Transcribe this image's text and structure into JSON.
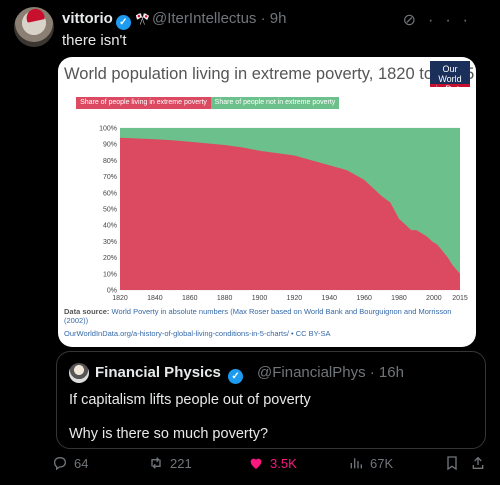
{
  "tweet": {
    "author_name": "vittorio",
    "handle_time": "@IterIntellectus · 9h",
    "text": "there isn't"
  },
  "chart_data": {
    "type": "area",
    "title": "World population living in extreme poverty, 1820 to 2015",
    "logo": "Our World in Data",
    "legend": [
      "Share of people living in extreme poverty",
      "Share of people not in extreme poverty"
    ],
    "x_ticks": [
      "1820",
      "1840",
      "1860",
      "1880",
      "1900",
      "1920",
      "1940",
      "1960",
      "1980",
      "2000",
      "2015"
    ],
    "y_ticks": [
      "0%",
      "10%",
      "20%",
      "30%",
      "40%",
      "50%",
      "60%",
      "70%",
      "80%",
      "90%",
      "100%"
    ],
    "x": [
      1820,
      1830,
      1840,
      1850,
      1860,
      1870,
      1880,
      1890,
      1900,
      1910,
      1920,
      1930,
      1940,
      1950,
      1960,
      1970,
      1975,
      1980,
      1983,
      1987,
      1990,
      1993,
      1996,
      1999,
      2002,
      2005,
      2008,
      2011,
      2015
    ],
    "values": [
      94,
      93.5,
      93,
      92.5,
      91.5,
      90.5,
      89.5,
      88,
      86,
      84.5,
      83,
      80,
      77,
      74,
      68,
      58,
      54,
      44,
      41,
      37,
      37,
      35,
      33,
      30,
      28,
      24,
      20,
      15,
      10
    ],
    "ylim": [
      0,
      100
    ],
    "colors": {
      "poverty": "#dc4a62",
      "not_poverty": "#6cc08b"
    },
    "source_label": "Data source:",
    "source_text": "World Poverty in absolute numbers (Max Roser based on World Bank and Bourguignon and Morrisson (2002))",
    "license_text": "OurWorldInData.org/a-history-of-global-living-conditions-in-5-charts/ • CC BY-SA"
  },
  "quote": {
    "author_name": "Financial Physics",
    "handle_time": "@FinancialPhys · 16h",
    "line1": "If capitalism lifts people out of poverty",
    "line2": "Why is there so much poverty?"
  },
  "actions": {
    "replies": "64",
    "reposts": "221",
    "likes": "3.5K",
    "views": "67K"
  }
}
